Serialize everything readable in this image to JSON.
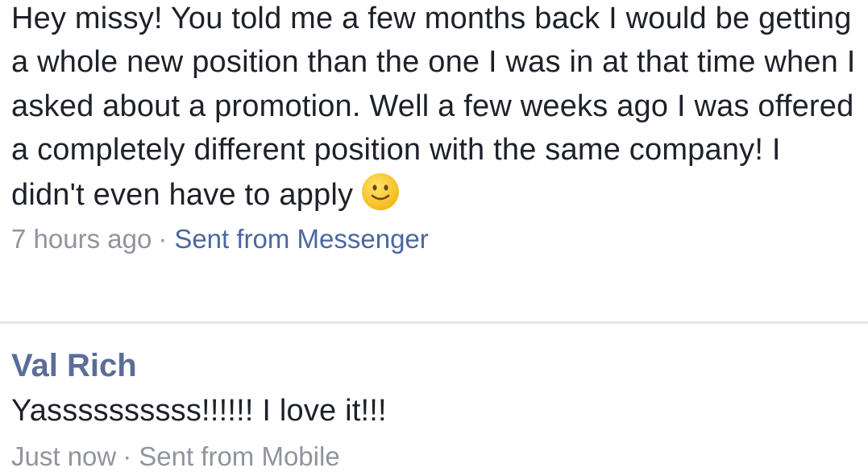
{
  "messages": [
    {
      "text": "Hey missy! You told me a few months back I would be getting a whole new position than the one I was in at that time when I asked about a promotion. Well a few weeks ago I was offered a completely different position with the same company! I didn't even have to apply",
      "emoji": "slightly-smiling-face-icon",
      "timestamp": "7 hours ago",
      "separator": "·",
      "source": "Sent from Messenger"
    },
    {
      "author": "Val Rich",
      "text": "Yassssssssss!!!!!! I love it!!!",
      "timestamp": "Just now",
      "separator": "·",
      "source": "Sent from Mobile"
    }
  ],
  "colors": {
    "text": "#1d2129",
    "meta": "#90949c",
    "link": "#4b67a1",
    "author": "#5b6d98",
    "divider": "#e5e6e9",
    "emoji_face": "#f7c72c"
  }
}
